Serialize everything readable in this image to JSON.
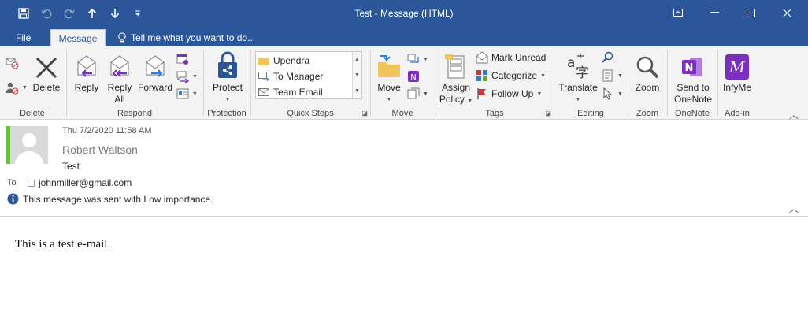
{
  "window": {
    "title": "Test - Message (HTML)"
  },
  "tabs": {
    "file": "File",
    "message": "Message",
    "tell_me": "Tell me what you want to do..."
  },
  "ribbon": {
    "delete_group": {
      "label": "Delete",
      "delete_button": "Delete"
    },
    "respond_group": {
      "label": "Respond",
      "reply": "Reply",
      "reply_all_1": "Reply",
      "reply_all_2": "All",
      "forward": "Forward"
    },
    "protection_group": {
      "label": "Protection",
      "protect": "Protect"
    },
    "quick_steps_group": {
      "label": "Quick Steps",
      "items": [
        "Upendra",
        "To Manager",
        "Team Email"
      ]
    },
    "move_group": {
      "label": "Move",
      "move": "Move"
    },
    "tags_group": {
      "label": "Tags",
      "assign_policy_1": "Assign",
      "assign_policy_2": "Policy",
      "mark_unread": "Mark Unread",
      "categorize": "Categorize",
      "follow_up": "Follow Up"
    },
    "editing_group": {
      "label": "Editing",
      "translate": "Translate"
    },
    "zoom_group": {
      "label": "Zoom",
      "zoom": "Zoom"
    },
    "onenote_group": {
      "label": "OneNote",
      "send_1": "Send to",
      "send_2": "OneNote"
    },
    "addin_group": {
      "label": "Add-in",
      "infyme": "InfyMe"
    }
  },
  "message": {
    "date": "Thu 7/2/2020 11:58 AM",
    "sender": "Robert Waltson",
    "subject": "Test",
    "to_label": "To",
    "to_address": "johnmiller@gmail.com",
    "importance_info": "This message was sent with Low importance.",
    "body": "This is a test e-mail."
  },
  "colors": {
    "titlebar": "#2b579a",
    "ribbon_bg": "#f3f3f3",
    "presence": "#6ec041",
    "accent_purple": "#7b2fbf"
  }
}
